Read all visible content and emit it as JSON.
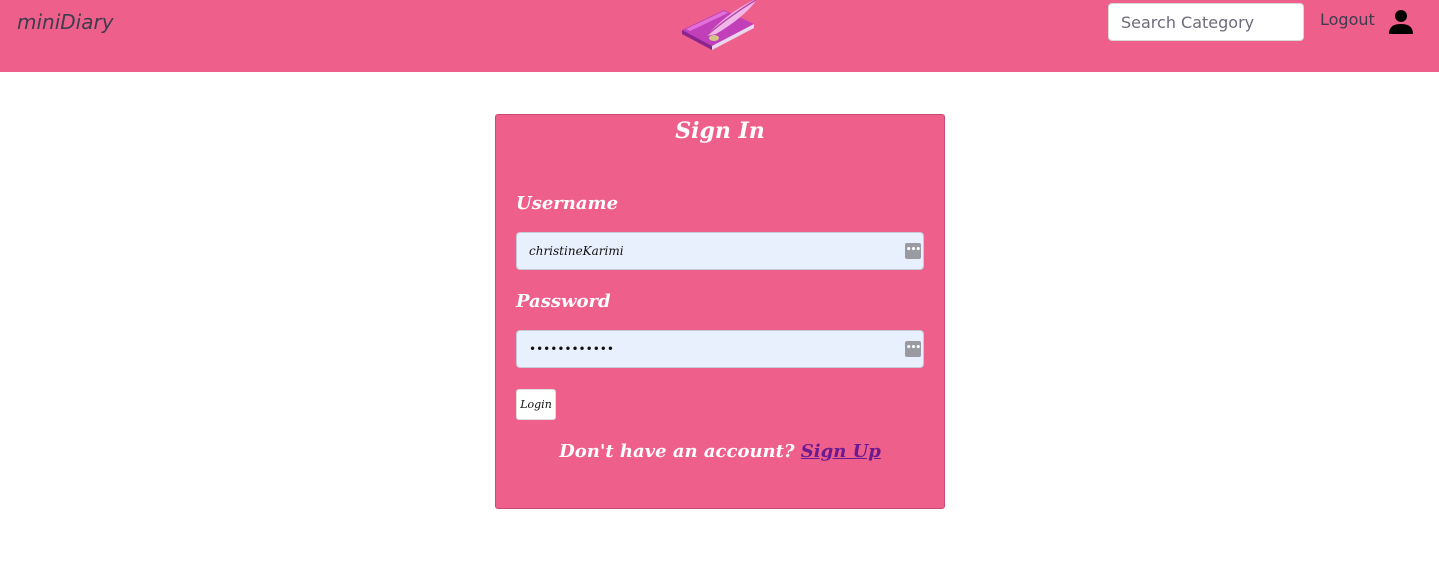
{
  "navbar": {
    "brand": "miniDiary",
    "logo_icon": "diary-book-quill-icon",
    "search": {
      "placeholder": "Search Category",
      "value": ""
    },
    "logout_label": "Logout",
    "user_icon": "person-icon",
    "background": "#ee5f8c"
  },
  "signin": {
    "title": "Sign In",
    "username_label": "Username",
    "username_value": "christineKarimi",
    "password_label": "Password",
    "password_value": "••••••••••••",
    "login_label": "Login",
    "signup_prompt": "Don't have an account?",
    "signup_link": "Sign Up",
    "field_icon": "password-manager-dots-icon",
    "card_color": "#ee5f8c",
    "link_color": "#6b1a8f"
  }
}
